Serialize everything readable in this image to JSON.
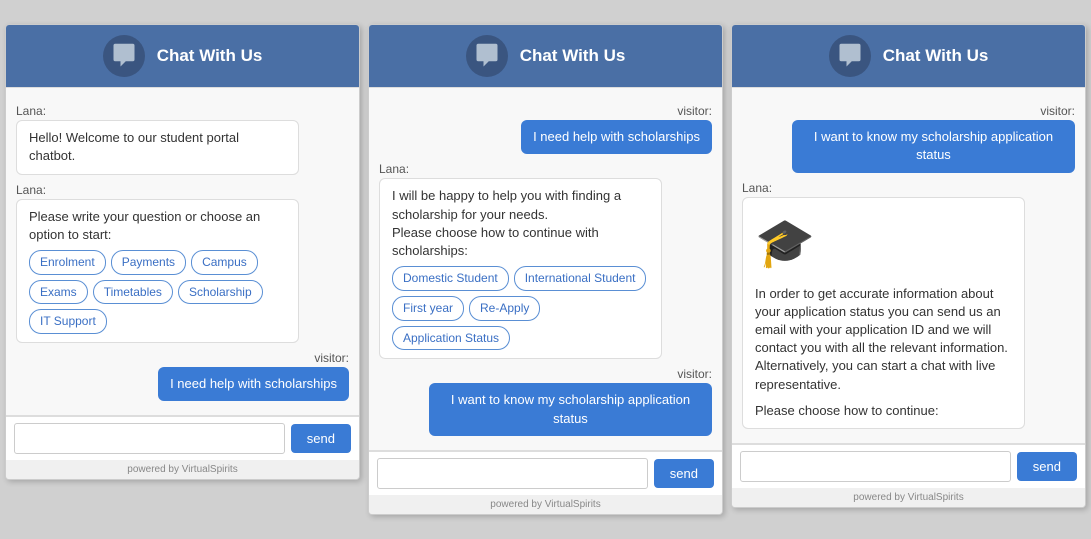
{
  "widgets": [
    {
      "id": "widget-1",
      "header": {
        "title": "Chat With Us"
      },
      "messages": [
        {
          "sender": "lana",
          "label": "Lana:",
          "text": "Hello! Welcome to our student portal chatbot.",
          "chips": []
        },
        {
          "sender": "lana",
          "label": "Lana:",
          "text": "Please write your question or choose an option to start:",
          "chips": [
            "Enrolment",
            "Payments",
            "Campus",
            "Exams",
            "Timetables",
            "Scholarship",
            "IT Support"
          ]
        },
        {
          "sender": "visitor",
          "label": "visitor:",
          "text": "I need help with scholarships",
          "chips": []
        }
      ],
      "input_placeholder": "",
      "send_label": "send",
      "powered_by": "powered by VirtualSpirits"
    },
    {
      "id": "widget-2",
      "header": {
        "title": "Chat With Us"
      },
      "messages": [
        {
          "sender": "visitor",
          "label": "visitor:",
          "text": "I need help with scholarships",
          "chips": []
        },
        {
          "sender": "lana",
          "label": "Lana:",
          "text": "I will be happy to help you with finding a scholarship for your needs.\nPlease choose how to continue with scholarships:",
          "chips": [
            "Domestic Student",
            "International Student",
            "First year",
            "Re-Apply",
            "Application Status"
          ]
        },
        {
          "sender": "visitor",
          "label": "visitor:",
          "text": "I want to know my scholarship application status",
          "chips": []
        }
      ],
      "input_placeholder": "",
      "send_label": "send",
      "powered_by": "powered by VirtualSpirits"
    },
    {
      "id": "widget-3",
      "header": {
        "title": "Chat With Us"
      },
      "messages": [
        {
          "sender": "visitor",
          "label": "visitor:",
          "text": "I want to know my scholarship application status",
          "chips": []
        },
        {
          "sender": "lana",
          "label": "Lana:",
          "has_grad_cap": true,
          "text": "In order to get accurate information about your application status you can send us an email with your application ID and we will contact you with all the relevant information. Alternatively, you can start a chat with live representative.",
          "extra_text": "Please choose how to continue:",
          "chips": []
        }
      ],
      "input_placeholder": "",
      "send_label": "send",
      "powered_by": "powered by VirtualSpirits"
    }
  ]
}
